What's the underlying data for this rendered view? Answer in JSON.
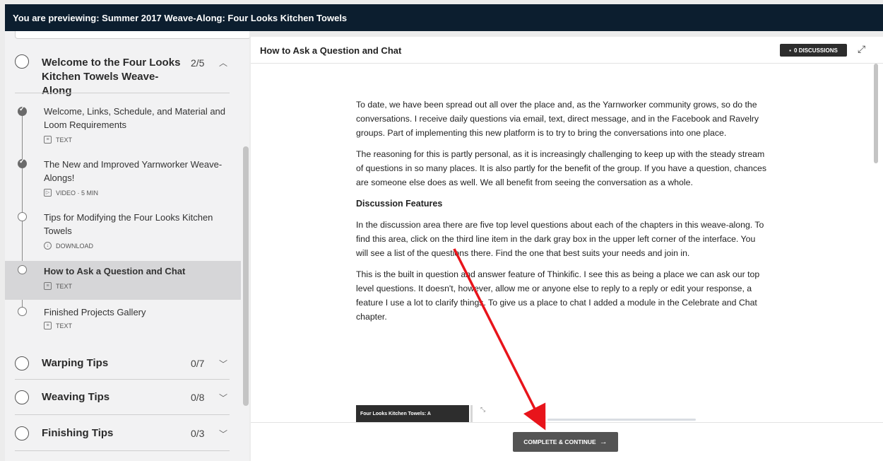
{
  "topbar": {
    "title": "You are previewing: Summer 2017 Weave-Along: Four Looks Kitchen Towels"
  },
  "sidebar": {
    "chapters": [
      {
        "title": "Welcome to the Four Looks Kitchen Towels Weave-Along",
        "count": "2/5",
        "expanded": true,
        "lessons": [
          {
            "title": "Welcome, Links, Schedule, and Material and Loom Requirements",
            "meta": "TEXT",
            "icon": "text-doc-icon",
            "complete": true
          },
          {
            "title": "The New and Improved Yarnworker Weave-Alongs!",
            "meta": "VIDEO · 5 MIN",
            "icon": "video-icon",
            "complete": true
          },
          {
            "title": "Tips for Modifying the Four Looks Kitchen Towels",
            "meta": "DOWNLOAD",
            "icon": "download-cloud-icon",
            "complete": false
          },
          {
            "title": "How to Ask a Question and Chat",
            "meta": "TEXT",
            "icon": "text-doc-icon",
            "complete": false,
            "active": true
          },
          {
            "title": "Finished Projects Gallery",
            "meta": "TEXT",
            "icon": "text-doc-icon",
            "complete": false
          }
        ]
      },
      {
        "title": "Warping Tips",
        "count": "0/7",
        "expanded": false
      },
      {
        "title": "Weaving Tips",
        "count": "0/8",
        "expanded": false
      },
      {
        "title": "Finishing Tips",
        "count": "0/3",
        "expanded": false
      }
    ]
  },
  "main": {
    "lesson_title": "How to Ask a Question and Chat",
    "discussions_label": "0 DISCUSSIONS",
    "paragraphs": [
      "To date, we have been spread out all over the place and, as the Yarnworker community grows, so do the conversations. I receive daily questions via email, text, direct message, and in the Facebook and Ravelry groups. Part of implementing this new platform is to try to bring the conversations into one place.",
      "The reasoning for this is partly personal, as it is increasingly challenging to keep up with the steady stream of questions in so many places. It is also partly for the benefit of the group. If you have a question, chances are someone else does as well. We all benefit from seeing the conversation as a whole."
    ],
    "subheading": "Discussion Features",
    "paragraphs2": [
      "In the discussion area there are five top level questions about each of the chapters in this weave-along. To find this area, click on the third line item in the dark gray box in the upper left corner of the interface. You will see a list of the questions there. Find the one that best suits your needs and join in.",
      "This is the built in question and answer feature of Thinkific. I see this as being a place we can ask our top level questions. It doesn't, however, allow me or anyone else to reply to a reply or edit your response, a feature I use a lot to clarify things. To give us a place to chat I added a module in the Celebrate and Chat chapter."
    ],
    "preview_caption": "Four Looks Kitchen Towels: A",
    "continue_label": "COMPLETE & CONTINUE",
    "continue_arrow": "→"
  },
  "colors": {
    "topbar": "#0c1e2f",
    "annotation_arrow": "#e8141b",
    "active_lesson": "#d6d6d8"
  }
}
